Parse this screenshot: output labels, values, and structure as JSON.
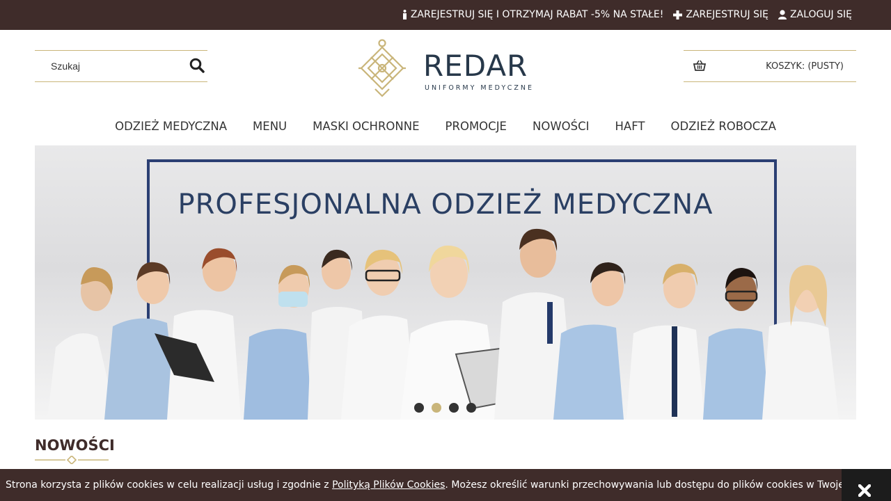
{
  "topbar": {
    "info_text": "ZAREJESTRUJ SIĘ I OTRZYMAJ RABAT -5% NA STAŁE!",
    "register_label": "ZAREJESTRUJ SIĘ",
    "login_label": "ZALOGUJ SIĘ",
    "background": "#3f2c2a"
  },
  "search": {
    "placeholder": "Szukaj",
    "icon": "search-icon"
  },
  "logo": {
    "brand": "REDAR",
    "tagline": "UNIFORMY MEDYCZNE",
    "accent": "#c9b57a"
  },
  "cart": {
    "label": "KOSZYK: (PUSTY)",
    "icon": "basket-icon"
  },
  "nav": {
    "items": [
      {
        "label": "ODZIEŻ MEDYCZNA"
      },
      {
        "label": "MENU"
      },
      {
        "label": "MASKI OCHRONNE"
      },
      {
        "label": "PROMOCJE"
      },
      {
        "label": "NOWOŚCI"
      },
      {
        "label": "HAFT"
      },
      {
        "label": "ODZIEŻ ROBOCZA"
      }
    ]
  },
  "banner": {
    "headline": "PROFESJONALNA ODZIEŻ MEDYCZNA",
    "slide_count": 4,
    "active_slide": 2
  },
  "section": {
    "title": "NOWOŚCI"
  },
  "cookie": {
    "text_before": "Strona korzysta z plików cookies w celu realizacji usług i zgodnie z ",
    "link_text": "Polityką Plików Cookies",
    "text_after": ". Możesz określić warunki przechowywania lub dostępu do plików cookies w Twojej przeglądarce.",
    "close_icon": "close-icon"
  }
}
